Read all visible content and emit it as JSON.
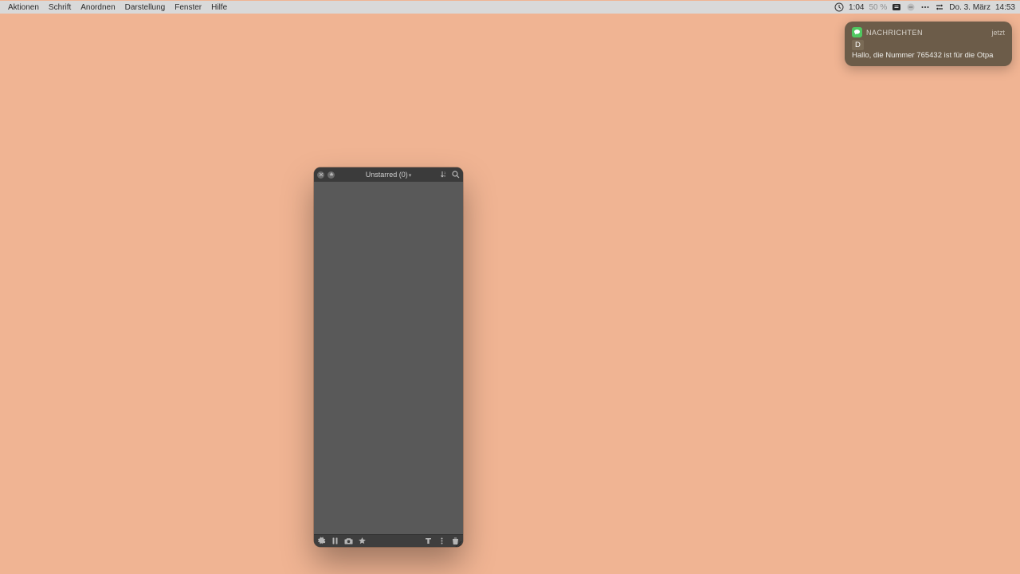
{
  "menubar": {
    "items": [
      "Aktionen",
      "Schrift",
      "Anordnen",
      "Darstellung",
      "Fenster",
      "Hilfe"
    ],
    "right": {
      "clock_small": "1:04",
      "percent": "50 %",
      "date": "Do. 3. März",
      "time": "14:53"
    }
  },
  "notification": {
    "app": "NACHRICHTEN",
    "when": "jetzt",
    "sender": "D",
    "body": "Hallo, die Nummer 765432 ist für die Otpa"
  },
  "window": {
    "title": "Unstarred (0)"
  }
}
